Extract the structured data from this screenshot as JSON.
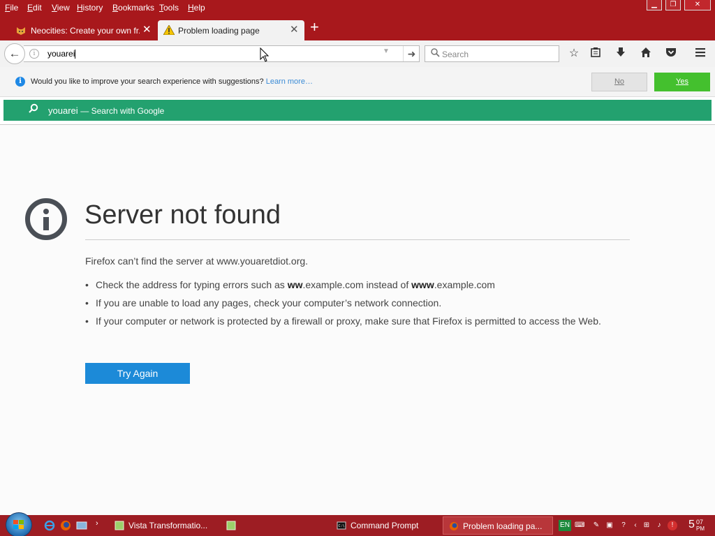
{
  "menu": [
    "File",
    "Edit",
    "View",
    "History",
    "Bookmarks",
    "Tools",
    "Help"
  ],
  "tabs": [
    {
      "label": "Neocities: Create your own fr...",
      "icon": "cat-icon",
      "active": false
    },
    {
      "label": "Problem loading page",
      "icon": "warning-icon",
      "active": true
    }
  ],
  "urlbar": {
    "value": "youarei"
  },
  "search": {
    "placeholder": "Search"
  },
  "notification": {
    "text": "Would you like to improve your search experience with suggestions?",
    "link": "Learn more…",
    "no_label": "No",
    "yes_label": "Yes"
  },
  "autocomplete": {
    "term": "youarei",
    "action": "— Search with Google"
  },
  "error": {
    "title": "Server not found",
    "description": "Firefox can’t find the server at www.youaretdiot.org.",
    "item1_pre": "Check the address for typing errors such as ",
    "item1_b1": "ww",
    "item1_mid": ".example.com instead of ",
    "item1_b2": "www",
    "item1_post": ".example.com",
    "item2": "If you are unable to load any pages, check your computer’s network connection.",
    "item3": "If your computer or network is protected by a firewall or proxy, make sure that Firefox is permitted to access the Web.",
    "button": "Try Again"
  },
  "taskbar": {
    "tasks": [
      "Vista Transformatio...",
      "Command Prompt",
      "Problem loading pa..."
    ],
    "language": "EN",
    "clock": {
      "hour": "5",
      "minute": "07",
      "ampm": "PM"
    }
  },
  "colors": {
    "chrome": "#a8181c",
    "accent_green": "#23a16f",
    "yes_button": "#44c02e",
    "try_again": "#1c8ad8"
  }
}
